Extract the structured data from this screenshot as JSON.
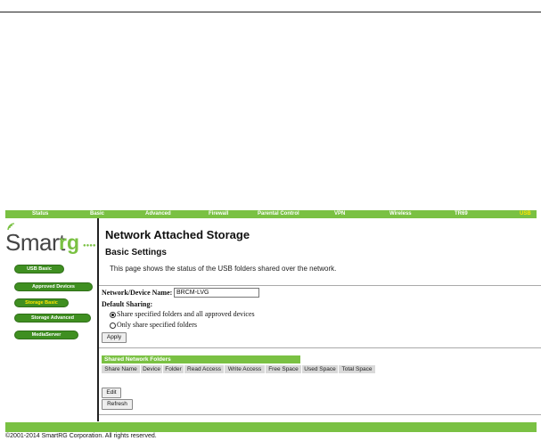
{
  "nav": {
    "items": [
      {
        "label": "Status"
      },
      {
        "label": "Basic"
      },
      {
        "label": "Advanced"
      },
      {
        "label": "Firewall"
      },
      {
        "label": "Parental Control"
      },
      {
        "label": "VPN"
      },
      {
        "label": "Wireless"
      },
      {
        "label": "TR69"
      },
      {
        "label": "USB"
      }
    ],
    "active": "USB"
  },
  "logo": {
    "smart": "Smart",
    "rg": "rg",
    "suffix": ""
  },
  "sidebar": {
    "items": [
      {
        "label": "USB Basic"
      },
      {
        "label": "Approved Devices"
      },
      {
        "label": "Storage Basic"
      },
      {
        "label": "Storage Advanced"
      },
      {
        "label": "MediaServer"
      }
    ],
    "active": "Storage Basic"
  },
  "page": {
    "title": "Network Attached Storage",
    "section_title": "Basic Settings",
    "description": "This page shows the status of the USB folders shared over the network."
  },
  "form": {
    "device_name_label": "Network/Device Name:",
    "device_name_value": "BRCM-LVG",
    "default_sharing_label": "Default Sharing:",
    "option_all": "Share specified folders and all approved devices",
    "option_specified": "Only share specified folders",
    "selected": "all",
    "apply_label": "Apply"
  },
  "folders": {
    "header": "Shared Network Folders",
    "columns": [
      "Share Name",
      "Device",
      "Folder",
      "Read Access",
      "Write Access",
      "Free Space",
      "Used Space",
      "Total Space"
    ],
    "rows": [],
    "edit_label": "Edit",
    "refresh_label": "Refresh"
  },
  "footer": {
    "copyright": "©2001-2014 SmartRG Corporation. All rights reserved."
  },
  "colors": {
    "brand_green": "#7ac143",
    "dark_green": "#3f8f21",
    "active_yellow": "#ffe600"
  }
}
